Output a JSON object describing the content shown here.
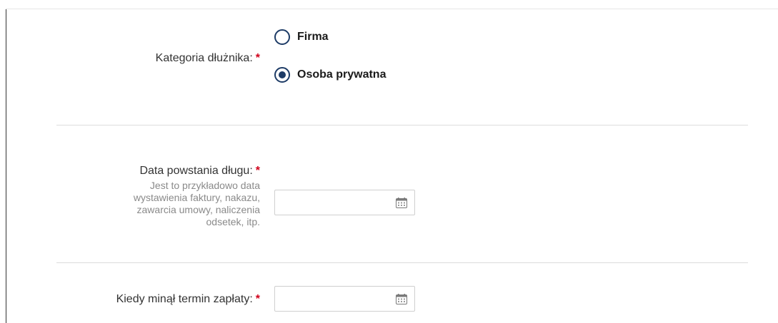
{
  "debtor_category": {
    "label": "Kategoria dłużnika:",
    "required_mark": "*",
    "options": [
      {
        "label": "Firma",
        "selected": false
      },
      {
        "label": "Osoba prywatna",
        "selected": true
      }
    ]
  },
  "debt_date": {
    "label": "Data powstania długu:",
    "required_mark": "*",
    "hint_lines": [
      "Jest to przykładowo data",
      "wystawienia faktury, nakazu,",
      "zawarcia umowy, naliczenia",
      "odsetek, itp."
    ],
    "value": "",
    "icon": "calendar-icon"
  },
  "due_date": {
    "label": "Kiedy minął termin zapłaty:",
    "required_mark": "*",
    "value": "",
    "icon": "calendar-icon"
  },
  "colors": {
    "accent": "#1d3b66",
    "required": "#d0021b",
    "hint": "#8a8a8a"
  }
}
